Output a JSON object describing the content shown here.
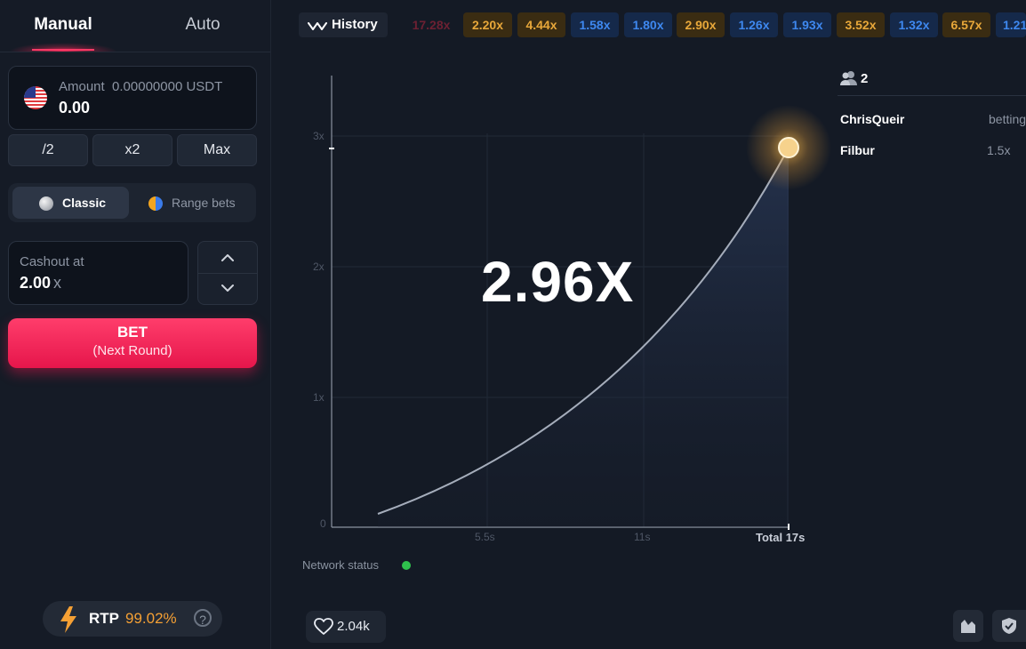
{
  "tabs": {
    "manual": "Manual",
    "auto": "Auto"
  },
  "amount": {
    "label": "Amount",
    "balance": "0.00000000 USDT",
    "value": "0.00"
  },
  "quick_buttons": {
    "half": "/2",
    "double": "x2",
    "max": "Max"
  },
  "bet_mode": {
    "classic": "Classic",
    "range": "Range bets"
  },
  "cashout": {
    "label": "Cashout at",
    "value": "2.00",
    "suffix": "x"
  },
  "bet_button": {
    "title": "BET",
    "subtitle": "(Next Round)"
  },
  "rtp": {
    "label": "RTP",
    "value": "99.02%",
    "help": "?"
  },
  "history": {
    "label": "History",
    "chips": [
      {
        "text": "17.28x",
        "tone": "red"
      },
      {
        "text": "2.20x",
        "tone": "gold"
      },
      {
        "text": "4.44x",
        "tone": "gold"
      },
      {
        "text": "1.58x",
        "tone": "blue"
      },
      {
        "text": "1.80x",
        "tone": "blue"
      },
      {
        "text": "2.90x",
        "tone": "gold"
      },
      {
        "text": "1.26x",
        "tone": "blue"
      },
      {
        "text": "1.93x",
        "tone": "blue"
      },
      {
        "text": "3.52x",
        "tone": "gold"
      },
      {
        "text": "1.32x",
        "tone": "blue"
      },
      {
        "text": "6.57x",
        "tone": "gold"
      },
      {
        "text": "1.21",
        "tone": "blue"
      }
    ]
  },
  "game": {
    "multiplier": "2.96X",
    "y_ticks": [
      "3x",
      "2x",
      "1x",
      "0"
    ],
    "x_ticks": [
      "5.5s",
      "11s",
      "Total 17s"
    ]
  },
  "network": {
    "label": "Network status",
    "color": "#2fc14d"
  },
  "likes": {
    "count": "2.04k"
  },
  "players": {
    "count": "2",
    "list": [
      {
        "name": "ChrisQueir",
        "value": "betting"
      },
      {
        "name": "Filbur",
        "value": "1.5x"
      }
    ]
  },
  "colors": {
    "accent": "#e6164b",
    "gold": "#e8a83a",
    "blue": "#3e88ef",
    "rtp": "#f5a034"
  }
}
